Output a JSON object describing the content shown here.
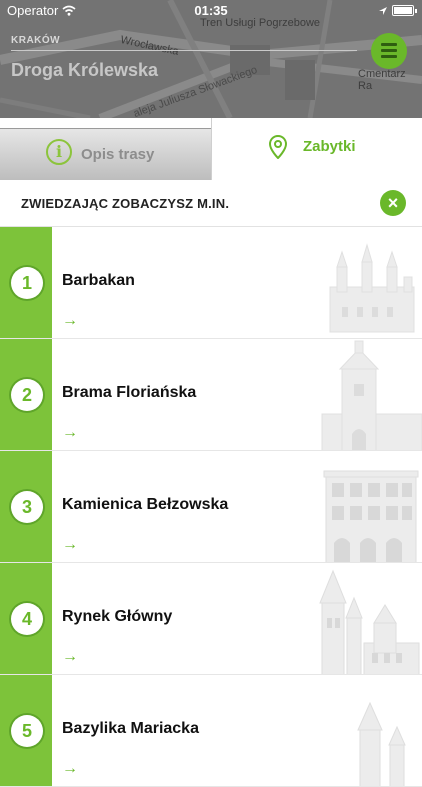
{
  "status": {
    "carrier": "Operator",
    "time": "01:35"
  },
  "map": {
    "labels": [
      "Tren Usługi Pogrzebowe",
      "Wrocławska",
      "aleja Juliusza Słowackiego",
      "Cmentarz Ra"
    ],
    "city": "KRAKÓW",
    "route_title": "Droga Królewska"
  },
  "tabs": {
    "route_description": "Opis trasy",
    "monuments": "Zabytki"
  },
  "section": {
    "title": "ZWIEDZAJĄC ZOBACZYSZ M.IN."
  },
  "items": [
    {
      "number": "1",
      "title": "Barbakan",
      "arrow": "→"
    },
    {
      "number": "2",
      "title": "Brama Floriańska",
      "arrow": "→"
    },
    {
      "number": "3",
      "title": "Kamienica Bełzowska",
      "arrow": "→"
    },
    {
      "number": "4",
      "title": "Rynek Główny",
      "arrow": "→"
    },
    {
      "number": "5",
      "title": "Bazylika Mariacka",
      "arrow": "→"
    }
  ],
  "colors": {
    "accent": "#6ab82a",
    "bar": "#7dc33a"
  }
}
